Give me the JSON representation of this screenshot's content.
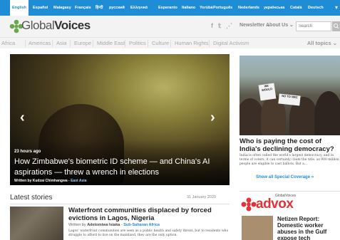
{
  "languages": [
    {
      "label": "English",
      "active": true
    },
    {
      "label": "Español"
    },
    {
      "label": "Malagasy"
    },
    {
      "label": "Français"
    },
    {
      "label": "हिन्दी"
    },
    {
      "label": "русский"
    },
    {
      "label": "Ελληνικά"
    },
    {
      "label": "Esperanto"
    },
    {
      "label": "Italiano"
    },
    {
      "label": "Yorùbá"
    },
    {
      "label": "Português"
    },
    {
      "label": "Nederlands"
    },
    {
      "label": "українська"
    },
    {
      "label": "Català"
    },
    {
      "label": "Deutsch"
    }
  ],
  "header": {
    "logo_light": "Global",
    "logo_bold": "Voices",
    "newsletter": "Newsletter ⌄",
    "about": "About Us ⌄",
    "search_placeholder": "Search"
  },
  "topics": [
    "Africa",
    "Americas",
    "Asia",
    "Europe",
    "Middle East",
    "Politics",
    "Culture",
    "Human Rights",
    "Digital Activism"
  ],
  "all_topics": "All topics ⌄",
  "hero": {
    "time": "23 hours ago",
    "title": "How Zimbabwe's biometric ID scheme — and China's AI aspirations — threw a wrench in elections",
    "byline_prefix": "Written by Kudzai Chimhangwa - ",
    "category": "East Asia"
  },
  "special": {
    "sign1": "WE",
    "sign2": "WOULD",
    "sign3": "NO TO NRC",
    "title": "Who is paying the cost of India's declining democracy?",
    "desc": "India is often called the world's largest democracy, and in terms of voters, it can certainly claim the title, as 900 million people are eligible to cast ballots. But a...",
    "link": "Show all Special Coverage »"
  },
  "latest": {
    "heading": "Latest stories",
    "date": "31 January 2020",
    "story": {
      "title": "Waterfront communities displaced by forced evictions in Lagos, Nigeria",
      "byline_prefix": "Written by ",
      "author": "Adetomiwa Isiaka",
      "separator": " - ",
      "category": "Sub-Saharan Africa",
      "excerpt": "Lagos' waterfront communities are seen as a public health and safety threat, but to residents who struggle to afford to live on the mainland, they are the only option."
    }
  },
  "advox": {
    "small": "GlobalVoices",
    "word": "advox",
    "title": "Netizen Report: Domestic worker abuses in the Gulf expose tech"
  },
  "colors": {
    "langbar": "#1f8dd6",
    "accent_red": "#e0333a",
    "logo_green": "#6aa84f"
  }
}
